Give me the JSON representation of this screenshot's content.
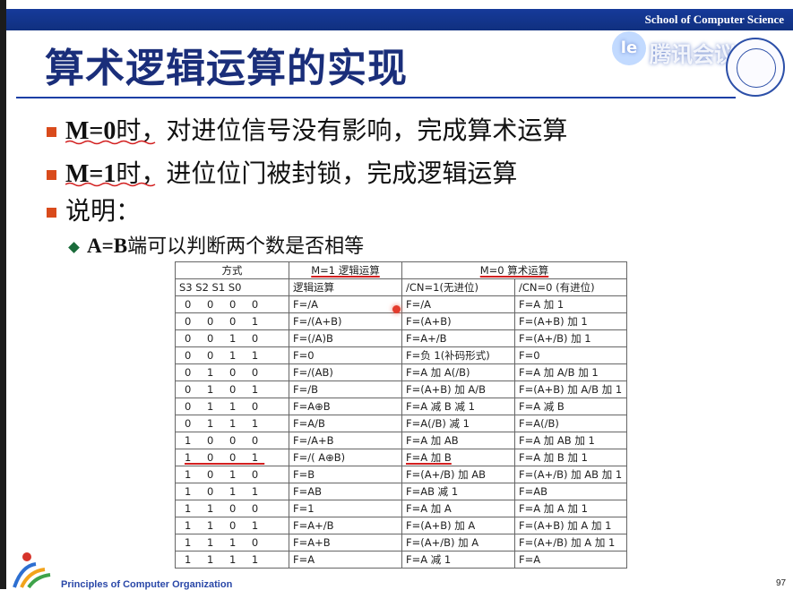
{
  "header": {
    "school": "School of Computer Science"
  },
  "title": "算术逻辑运算的实现",
  "watermark": {
    "icon": "tencent-meeting-icon",
    "glyph": "le",
    "text": "腾讯会议"
  },
  "bullets": [
    {
      "key": "M=0",
      "text": "时，对进位信号没有影响，完成算术运算"
    },
    {
      "key": "M=1",
      "text": "时，进位位门被封锁，完成逻辑运算"
    },
    {
      "key": "",
      "text": "说明："
    }
  ],
  "sub_bullet": {
    "key": "A=B",
    "text": "端可以判断两个数是否相等"
  },
  "table": {
    "group_headers": [
      "方式",
      "M=1 逻辑运算",
      "M=0 算术运算"
    ],
    "sub_headers": [
      "S3 S2 S1 S0",
      "逻辑运算",
      "/CN=1(无进位)",
      "/CN=0 (有进位)"
    ],
    "rows": [
      [
        "0 0 0 0",
        "F=/A",
        "F=/A",
        "F=A 加 1"
      ],
      [
        "0 0 0 1",
        "F=/(A+B)",
        "F=(A+B)",
        "F=(A+B) 加 1"
      ],
      [
        "0 0 1 0",
        "F=(/A)B",
        "F=A+/B",
        "F=(A+/B) 加 1"
      ],
      [
        "0 0 1 1",
        "F=0",
        "F=负 1(补码形式)",
        "F=0"
      ],
      [
        "0 1 0 0",
        "F=/(AB)",
        "F=A 加 A(/B)",
        "F=A 加 A/B 加 1"
      ],
      [
        "0 1 0 1",
        "F=/B",
        "F=(A+B) 加 A/B",
        "F=(A+B) 加 A/B 加 1"
      ],
      [
        "0 1 1 0",
        "F=A⊕B",
        "F=A 减 B 减 1",
        "F=A 减 B"
      ],
      [
        "0 1 1 1",
        "F=A/B",
        "F=A(/B) 减 1",
        "F=A(/B)"
      ],
      [
        "1 0 0 0",
        "F=/A+B",
        "F=A 加 AB",
        "F=A 加 AB 加 1"
      ],
      [
        "1 0 0 1",
        "F=/( A⊕B)",
        "F=A 加 B",
        "F=A 加 B 加 1"
      ],
      [
        "1 0 1 0",
        "F=B",
        "F=(A+/B) 加 AB",
        "F=(A+/B) 加 AB 加 1"
      ],
      [
        "1 0 1 1",
        "F=AB",
        "F=AB 减 1",
        "F=AB"
      ],
      [
        "1 1 0 0",
        "F=1",
        "F=A 加 A",
        "F=A 加 A 加 1"
      ],
      [
        "1 1 0 1",
        "F=A+/B",
        "F=(A+B) 加 A",
        "F=(A+B) 加 A 加 1"
      ],
      [
        "1 1 1 0",
        "F=A+B",
        "F=(A+/B) 加 A",
        "F=(A+/B) 加 A 加 1"
      ],
      [
        "1 1 1 1",
        "F=A",
        "F=A 减 1",
        "F=A"
      ]
    ]
  },
  "footer": {
    "brand": "Principles of Computer Organization",
    "page": "97"
  },
  "colors": {
    "header_bar": "#163a9a",
    "title": "#1a2e7a",
    "bullet": "#d94b1c",
    "annotation": "#d21f1f"
  }
}
